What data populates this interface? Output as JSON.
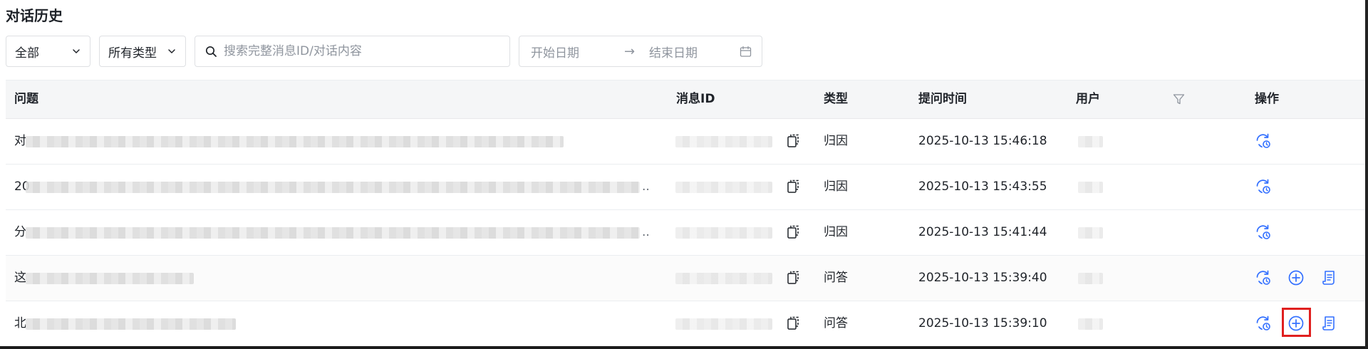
{
  "page": {
    "title": "对话历史"
  },
  "filters": {
    "scope": {
      "value": "全部",
      "icon": "chevron-down-icon"
    },
    "type": {
      "value": "所有类型",
      "icon": "chevron-down-icon"
    },
    "search": {
      "placeholder": "搜索完整消息ID/对话内容",
      "icon": "search-icon"
    },
    "date_range": {
      "start_placeholder": "开始日期",
      "arrow": "→",
      "end_placeholder": "结束日期",
      "icon": "calendar-icon"
    }
  },
  "table": {
    "columns": {
      "question": "问题",
      "message_id": "消息ID",
      "type": "类型",
      "time": "提问时间",
      "user": "用户",
      "actions": "操作"
    },
    "rows": [
      {
        "question_start": "对",
        "question_truncated": false,
        "type": "归因",
        "time": "2025-10-13 15:46:18",
        "actions": [
          "retry"
        ]
      },
      {
        "question_start": "20",
        "question_truncated": true,
        "type": "归因",
        "time": "2025-10-13 15:43:55",
        "actions": [
          "retry"
        ]
      },
      {
        "question_start": "分",
        "question_truncated": true,
        "type": "归因",
        "time": "2025-10-13 15:41:44",
        "actions": [
          "retry"
        ]
      },
      {
        "question_start": "这",
        "question_truncated": false,
        "type": "问答",
        "time": "2025-10-13 15:39:40",
        "actions": [
          "retry",
          "add",
          "doc"
        ]
      },
      {
        "question_start": "北",
        "question_truncated": false,
        "type": "问答",
        "time": "2025-10-13 15:39:10",
        "actions": [
          "retry",
          "add",
          "doc"
        ],
        "highlighted_action": "add"
      }
    ],
    "ellipsis": "..",
    "icons": {
      "copy": "copy-icon",
      "filter": "filter-icon",
      "retry": "retry-icon",
      "add": "add-circle-icon",
      "doc": "document-icon"
    }
  },
  "colors": {
    "accent": "#3370ff",
    "highlight": "#e0201f",
    "header_bg": "#f5f6f7",
    "border": "#dee0e3"
  }
}
